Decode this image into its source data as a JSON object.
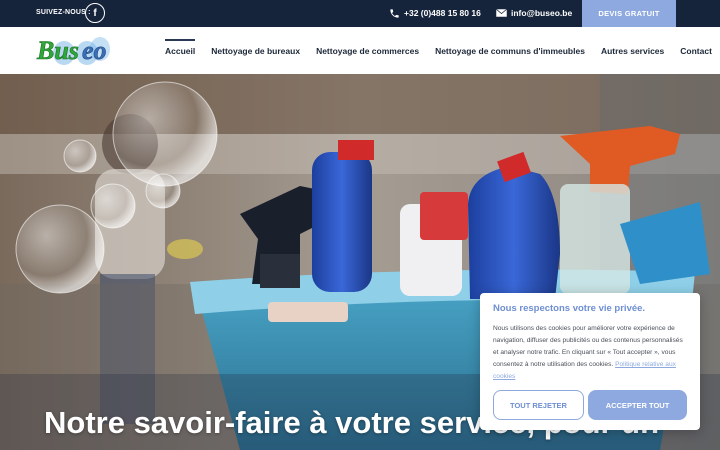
{
  "topbar": {
    "follow_label": "SUIVEZ-NOUS :",
    "facebook_glyph": "f",
    "phone": "+32 (0)488 15 80 16",
    "email": "info@buseo.be",
    "cta": "DEVIS GRATUIT"
  },
  "header": {
    "logo_text": "Buseo",
    "nav": [
      {
        "label": "Accueil",
        "active": true
      },
      {
        "label": "Nettoyage de bureaux"
      },
      {
        "label": "Nettoyage de commerces"
      },
      {
        "label": "Nettoyage de communs d'immeubles"
      },
      {
        "label": "Autres services"
      },
      {
        "label": "Contact"
      }
    ]
  },
  "hero": {
    "title": "Notre savoir-faire à votre service, pour un"
  },
  "cookie": {
    "title": "Nous respectons votre vie privée.",
    "text": "Nous utilisons des cookies pour améliorer votre expérience de navigation, diffuser des publicités ou des contenus personnalisés et analyser notre trafic. En cliquant sur « Tout accepter », vous consentez à notre utilisation des cookies.",
    "link": "Politique relative aux cookies",
    "reject_label": "TOUT REJETER",
    "accept_label": "ACCEPTER TOUT"
  },
  "colors": {
    "topbar_bg": "#16243b",
    "accent": "#8ea9e0",
    "logo_green": "#2fa83a",
    "logo_blue": "#3a6fb8"
  }
}
